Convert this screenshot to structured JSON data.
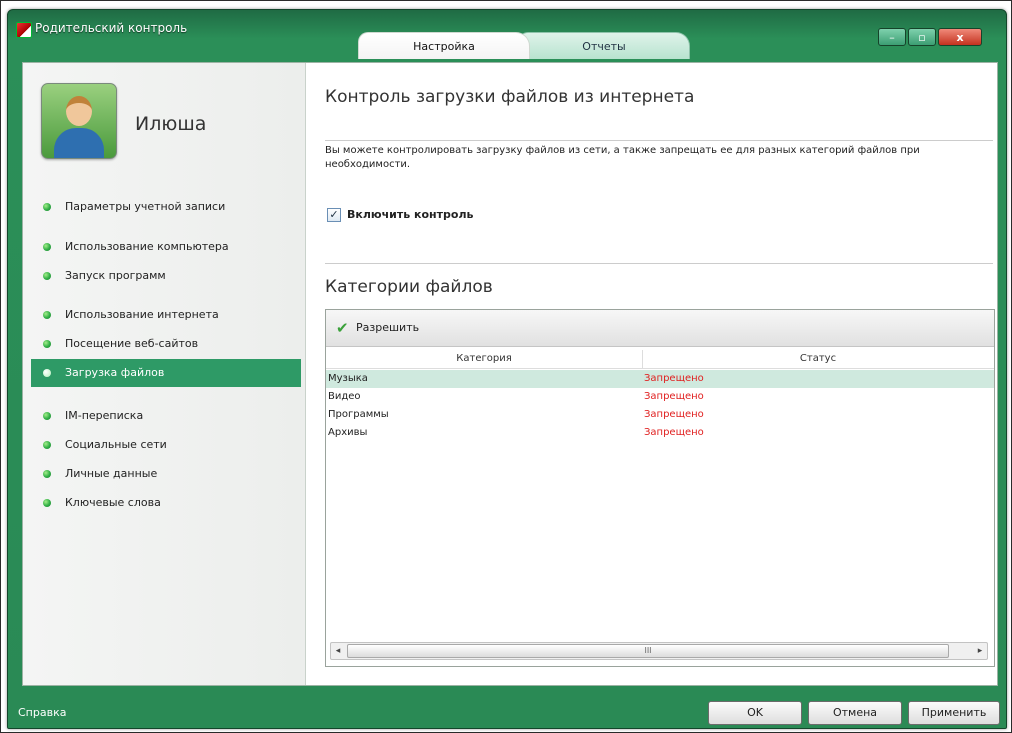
{
  "window": {
    "title": "Родительский контроль",
    "tabs": [
      {
        "label": "Настройка",
        "active": true
      },
      {
        "label": "Отчеты",
        "active": false
      }
    ],
    "controls": {
      "minimize": "–",
      "maximize": "▫",
      "close": "x"
    }
  },
  "sidebar": {
    "user_name": "Илюша",
    "items": [
      {
        "label": "Параметры учетной записи",
        "active": false
      },
      {
        "label": "Использование компьютера",
        "active": false
      },
      {
        "label": "Запуск программ",
        "active": false
      },
      {
        "label": "Использование интернета",
        "active": false
      },
      {
        "label": "Посещение веб-сайтов",
        "active": false
      },
      {
        "label": "Загрузка файлов",
        "active": true
      },
      {
        "label": "IM-переписка",
        "active": false
      },
      {
        "label": "Социальные сети",
        "active": false
      },
      {
        "label": "Личные данные",
        "active": false
      },
      {
        "label": "Ключевые слова",
        "active": false
      }
    ]
  },
  "main": {
    "title": "Контроль загрузки файлов из интернета",
    "description": "Вы можете контролировать загрузку файлов из сети, а также запрещать ее для разных категорий файлов при необходимости.",
    "enable_control": {
      "label": "Включить контроль",
      "checked": true
    },
    "categories_title": "Категории файлов",
    "allow_button": "Разрешить",
    "table": {
      "columns": [
        "Категория",
        "Статус"
      ],
      "rows": [
        {
          "category": "Музыка",
          "status": "Запрещено",
          "selected": true
        },
        {
          "category": "Видео",
          "status": "Запрещено",
          "selected": false
        },
        {
          "category": "Программы",
          "status": "Запрещено",
          "selected": false
        },
        {
          "category": "Архивы",
          "status": "Запрещено",
          "selected": false
        }
      ]
    },
    "scrollbar": {
      "left": "◂",
      "right": "▸",
      "grip": "III"
    }
  },
  "footer": {
    "help": "Справка",
    "ok": "OK",
    "cancel": "Отмена",
    "apply": "Применить"
  },
  "colors": {
    "frame": "#2a8a55",
    "active_item": "#2e9a66",
    "status_denied": "#e02020",
    "selected_row": "#cfe9de"
  }
}
